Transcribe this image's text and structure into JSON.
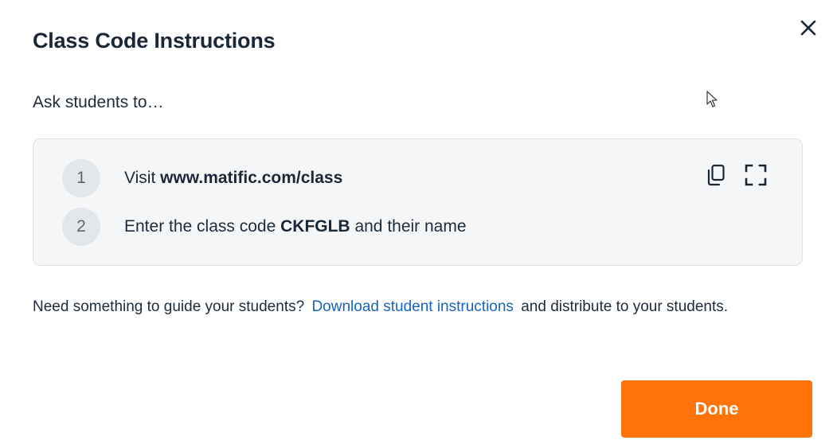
{
  "modal": {
    "title": "Class Code Instructions",
    "close_icon": "close-icon",
    "subtitle": "Ask students to…"
  },
  "steps": [
    {
      "number": "1",
      "prefix": "Visit ",
      "bold": "www.matific.com/class",
      "suffix": ""
    },
    {
      "number": "2",
      "prefix": "Enter the class code ",
      "bold": "CKFGLB",
      "suffix": " and their name"
    }
  ],
  "actions": {
    "copy_icon": "copy-icon",
    "fullscreen_icon": "fullscreen-icon"
  },
  "guide": {
    "text_before": "Need something to guide your students? ",
    "link_text": "Download student instructions",
    "text_after": " and distribute to your students."
  },
  "footer": {
    "done_label": "Done"
  },
  "colors": {
    "primary_button": "#ff7308",
    "link": "#1565c0",
    "steps_background": "#f5f6f8"
  }
}
